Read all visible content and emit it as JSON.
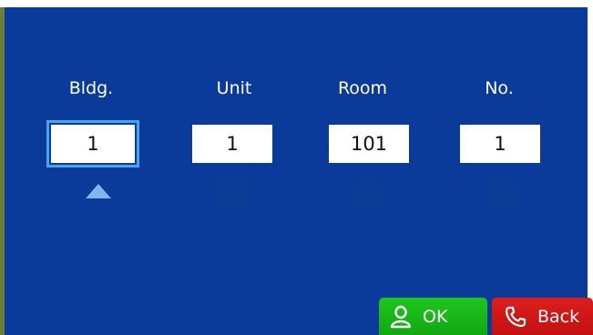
{
  "fields": [
    {
      "label": "Bldg.",
      "value": "1",
      "selected": true
    },
    {
      "label": "Unit",
      "value": "1",
      "selected": false
    },
    {
      "label": "Room",
      "value": "101",
      "selected": false
    },
    {
      "label": "No.",
      "value": "1",
      "selected": false
    }
  ],
  "buttons": {
    "ok_label": "OK",
    "back_label": "Back"
  },
  "icons": {
    "ok": "person-icon",
    "back": "phone-icon",
    "selection_marker": "triangle-up-icon"
  },
  "colors": {
    "background": "#0a3a9a",
    "selection_outline": "#4aa3ef",
    "ok_button": "#18b418",
    "back_button": "#d01818"
  }
}
